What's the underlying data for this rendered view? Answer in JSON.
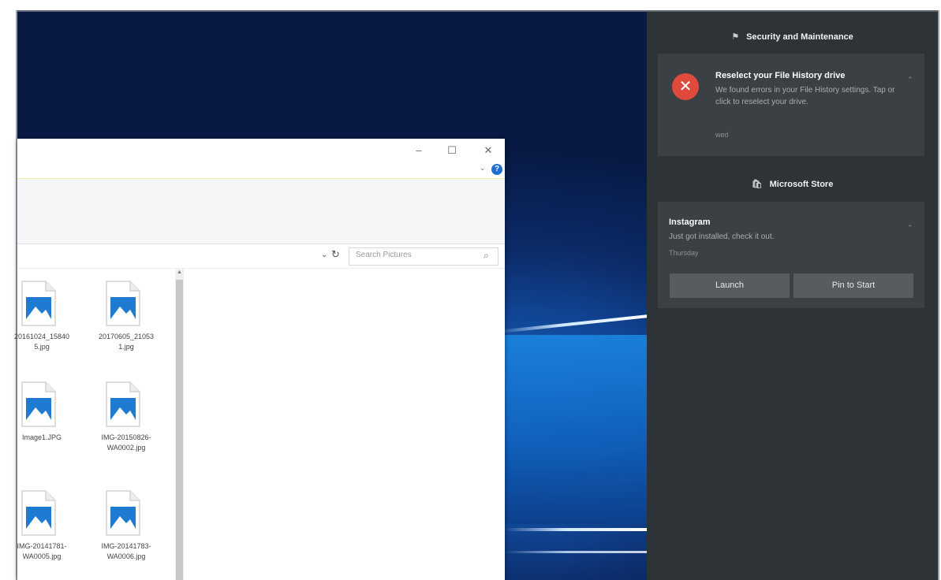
{
  "explorer": {
    "window_controls": {
      "minimize": "–",
      "maximize": "☐",
      "close": "✕"
    },
    "help_label": "?",
    "ribbon_chevron": "⌄",
    "address_dropdown": "⌄",
    "refresh_glyph": "↻",
    "search_placeholder": "Search Pictures",
    "scroll_up": "▲",
    "files": [
      {
        "name": "20161024_15840 5.jpg"
      },
      {
        "name": "20170605_21053 1.jpg"
      },
      {
        "name": "Image1.JPG"
      },
      {
        "name": "IMG-20150826-WA0002.jpg"
      },
      {
        "name": "IMG-20141781-WA0005.jpg"
      },
      {
        "name": "IMG-20141783-WA0006.jpg"
      }
    ]
  },
  "action_center": {
    "groups": [
      {
        "header": "Security and Maintenance",
        "icon": "flag-icon",
        "icon_glyph": "⚑",
        "notification": {
          "title": "Reselect your File History drive",
          "body": "We found errors in your File History settings. Tap or click to reselect your drive.",
          "time": "wed",
          "icon_glyph": "✕"
        }
      },
      {
        "header": "Microsoft Store",
        "icon": "store-bag-icon",
        "icon_glyph": "🛍",
        "notification": {
          "title": "Instagram",
          "body": "Just got installed, check it out.",
          "time": "Thursday",
          "actions": [
            "Launch",
            "Pin to Start"
          ]
        }
      }
    ],
    "chevron_glyph": "⌃"
  },
  "colors": {
    "action_center_bg": "#2e3337",
    "card_bg": "#3b4045",
    "button_bg": "#575c61",
    "error_red": "#e04a3c",
    "help_blue": "#1e6fd1"
  }
}
